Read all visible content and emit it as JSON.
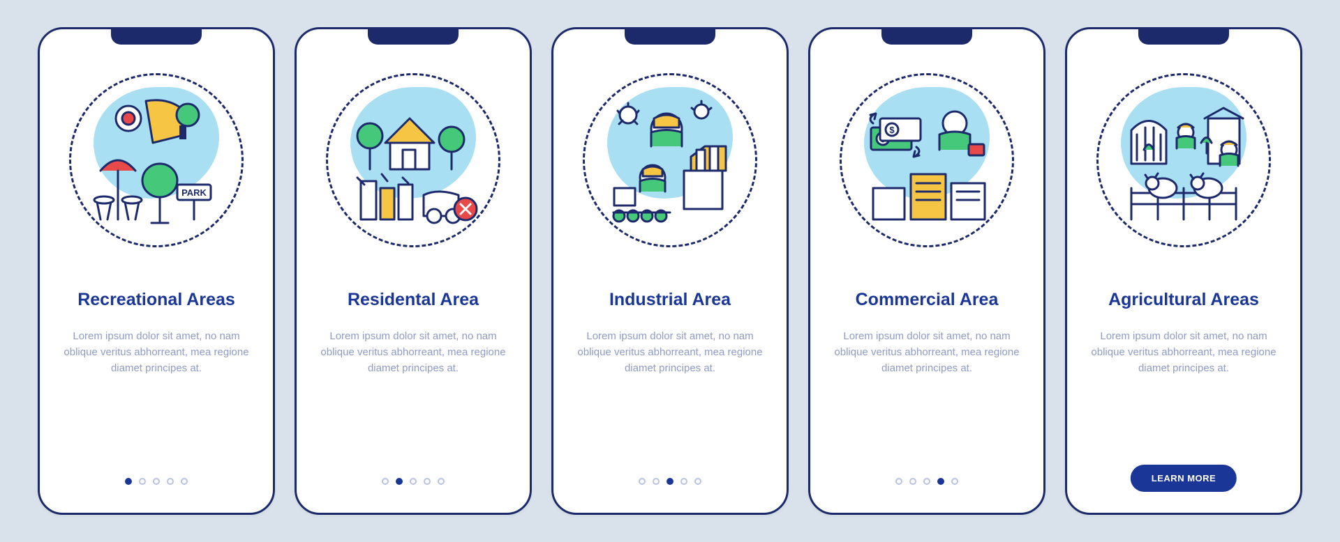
{
  "colors": {
    "background": "#d9e2ea",
    "frame": "#1c2a6b",
    "title": "#1a3696",
    "desc": "#8f9bc9",
    "blob": "#a9dff2",
    "dot_inactive_border": "#b9c2e0",
    "dot_active": "#1a3696",
    "cta_bg": "#1a3696",
    "cta_text": "#ffffff",
    "accent_green": "#45c879",
    "accent_yellow": "#f6c544",
    "accent_red": "#e84a4a"
  },
  "screens": [
    {
      "icon": "recreational-illustration",
      "title": "Recreational Areas",
      "desc": "Lorem ipsum dolor sit amet, no nam oblique veritus abhorreant, mea regione diamet principes at.",
      "active_index": 0,
      "total": 5,
      "has_cta": false
    },
    {
      "icon": "residential-illustration",
      "title": "Residental Area",
      "desc": "Lorem ipsum dolor sit amet, no nam oblique veritus abhorreant, mea regione diamet principes at.",
      "active_index": 1,
      "total": 5,
      "has_cta": false
    },
    {
      "icon": "industrial-illustration",
      "title": "Industrial Area",
      "desc": "Lorem ipsum dolor sit amet, no nam oblique veritus abhorreant, mea regione diamet principes at.",
      "active_index": 2,
      "total": 5,
      "has_cta": false
    },
    {
      "icon": "commercial-illustration",
      "title": "Commercial Area",
      "desc": "Lorem ipsum dolor sit amet, no nam oblique veritus abhorreant, mea regione diamet principes at.",
      "active_index": 3,
      "total": 5,
      "has_cta": false
    },
    {
      "icon": "agricultural-illustration",
      "title": "Agricultural Areas",
      "desc": "Lorem ipsum dolor sit amet, no nam oblique veritus abhorreant, mea regione diamet principes at.",
      "active_index": 4,
      "total": 5,
      "has_cta": true,
      "cta_label": "LEARN MORE"
    }
  ]
}
